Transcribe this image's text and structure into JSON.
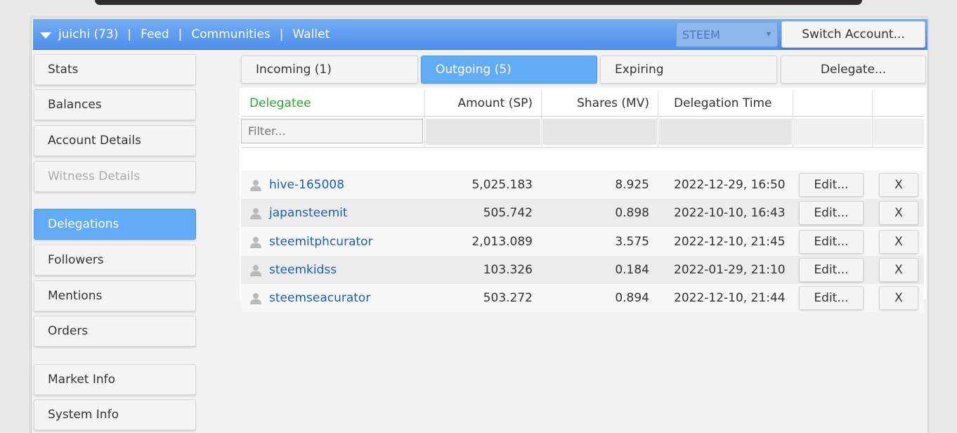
{
  "header": {
    "account": "juichi (73)",
    "nav": [
      "Feed",
      "Communities",
      "Wallet"
    ],
    "separator": "|",
    "chain_select": "STEEM",
    "switch_account": "Switch Account..."
  },
  "sidebar": {
    "items": [
      {
        "label": "Stats",
        "state": "normal"
      },
      {
        "label": "Balances",
        "state": "normal"
      },
      {
        "label": "Account Details",
        "state": "normal"
      },
      {
        "label": "Witness Details",
        "state": "disabled"
      },
      {
        "label": "Delegations",
        "state": "active"
      },
      {
        "label": "Followers",
        "state": "normal"
      },
      {
        "label": "Mentions",
        "state": "normal"
      },
      {
        "label": "Orders",
        "state": "normal"
      },
      {
        "label": "Market Info",
        "state": "normal"
      },
      {
        "label": "System Info",
        "state": "normal"
      }
    ]
  },
  "tabs": {
    "incoming": "Incoming (1)",
    "outgoing": "Outgoing (5)",
    "expiring": "Expiring",
    "delegate": "Delegate..."
  },
  "table": {
    "columns": {
      "delegatee": "Delegatee",
      "amount": "Amount (SP)",
      "shares": "Shares (MV)",
      "time": "Delegation Time"
    },
    "filter_placeholder": "Filter...",
    "edit_label": "Edit...",
    "remove_label": "X",
    "rows": [
      {
        "user": "hive-165008",
        "amount": "5,025.183",
        "shares": "8.925",
        "time": "2022-12-29, 16:50"
      },
      {
        "user": "japansteemit",
        "amount": "505.742",
        "shares": "0.898",
        "time": "2022-10-10, 16:43"
      },
      {
        "user": "steemitphcurator",
        "amount": "2,013.089",
        "shares": "3.575",
        "time": "2022-12-10, 21:45"
      },
      {
        "user": "steemkidss",
        "amount": "103.326",
        "shares": "0.184",
        "time": "2022-01-29, 21:10"
      },
      {
        "user": "steemseacurator",
        "amount": "503.272",
        "shares": "0.894",
        "time": "2022-12-10, 21:44"
      }
    ]
  },
  "colors": {
    "header_blue": "#5f9bef",
    "active_blue": "#62abf7",
    "delegatee_header": "#2aa82a",
    "link": "#1a5fb4"
  }
}
